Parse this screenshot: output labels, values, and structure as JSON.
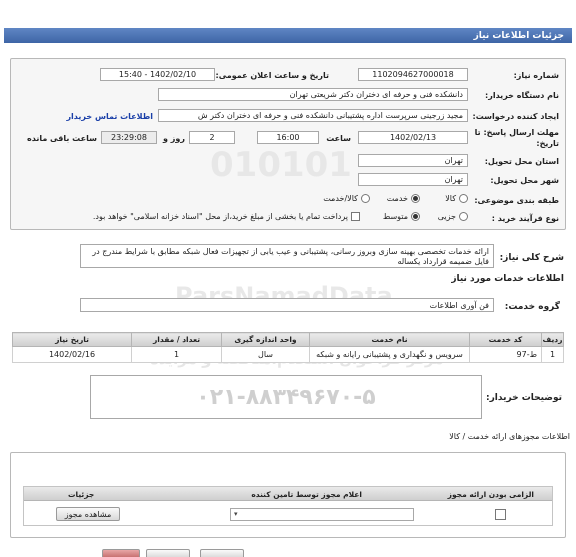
{
  "header": {
    "title": "جزئیات اطلاعات نیاز"
  },
  "form": {
    "need_number_label": "شماره نیاز:",
    "need_number": "1102094627000018",
    "announce_label": "تاریخ و ساعت اعلان عمومی:",
    "announce_value": "1402/02/10 - 15:40",
    "buyer_org_label": "نام دستگاه خریدار:",
    "buyer_org": "دانشکده فنی و حرفه ای دختران دکتر شریعتی تهران",
    "requester_label": "ایجاد کننده درخواست:",
    "requester": "مجید زرجینی سرپرست اداره پشتیبانی دانشکده فنی و حرفه ای دختران دکتر ش",
    "contact_link": "اطلاعات تماس خریدار",
    "deadline_label": "مهلت ارسال پاسخ: تا",
    "deadline_label2": "تاریخ:",
    "deadline_date": "1402/02/13",
    "time_label": "ساعت",
    "deadline_time": "16:00",
    "days_value": "2",
    "days_label": "روز و",
    "remaining_time": "23:29:08",
    "remaining_label": "ساعت باقی مانده",
    "province_label": "استان محل تحویل:",
    "province": "تهران",
    "city_label": "شهر محل تحویل:",
    "city": "تهران",
    "category_label": "طبقه بندی موضوعی:",
    "category_options": [
      "کالا",
      "خدمت",
      "کالا/خدمت"
    ],
    "process_label": "نوع فرآیند خرید :",
    "process_options": [
      "جزیی",
      "متوسط"
    ],
    "payment_note": "پرداخت تمام یا بخشی از مبلغ خرید،از محل \"اسناد خزانه اسلامی\" خواهد بود."
  },
  "description": {
    "label": "شرح کلی نیاز:",
    "text": "ارائه خدمات تخصصی بهینه سازی وبروز رسانی، پشتیبانی و عیب یابی  از تجهیزات فعال شبکه مطابق با شرایط مندرج در فایل ضمیمه قرارداد یکساله"
  },
  "services_section": {
    "title": "اطلاعات خدمات مورد نیاز",
    "group_label": "گروه خدمت:",
    "group_value": "فن آوری اطلاعات",
    "columns": [
      "ردیف",
      "کد خدمت",
      "نام خدمت",
      "واحد اندازه گیری",
      "تعداد / مقدار",
      "تاریخ نیاز"
    ],
    "rows": [
      [
        "1",
        "ط-97",
        "سرویس و نگهداری و پشتیبانی رایانه و شبکه",
        "سال",
        "1",
        "1402/02/16"
      ]
    ]
  },
  "buyer_notes": {
    "label": "توضیحات خریدار:",
    "watermark_phone": "۰۲۱-۸۸۳۴۹۶۷۰-۵"
  },
  "permits_section": {
    "title": "اطلاعات مجوزهای ارائه خدمت / کالا",
    "columns": [
      "الزامی بودن ارائه مجوز",
      "اعلام مجوز توسط تامین کننده",
      "جزئیات"
    ],
    "view_button": "مشاهده مجوز"
  },
  "watermark": {
    "brand": "ParsNamadData",
    "tagline": "مرکز فراخوان استعلام،مناقصه و مزایده"
  }
}
